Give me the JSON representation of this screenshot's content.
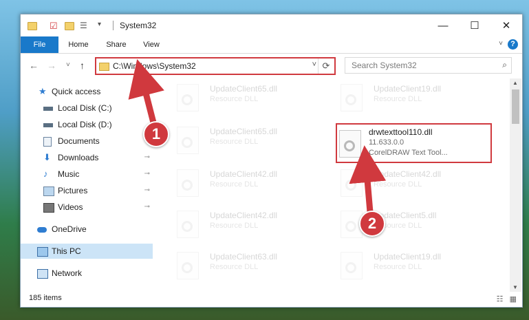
{
  "window": {
    "title": "System32",
    "controls": {
      "minimize": "—",
      "maximize": "☐",
      "close": "✕"
    }
  },
  "ribbon": {
    "tabs": [
      {
        "label": "File"
      },
      {
        "label": "Home"
      },
      {
        "label": "Share"
      },
      {
        "label": "View"
      }
    ],
    "help": "?",
    "chevron": "˅"
  },
  "address": {
    "path": "C:\\Windows\\System32",
    "dropdown": "˅",
    "refresh": "⟳"
  },
  "search": {
    "placeholder": "Search System32",
    "icon": "⌕"
  },
  "nav": {
    "back": "←",
    "forward": "→",
    "recent": "˅",
    "up": "↑"
  },
  "sidebar": {
    "items": [
      {
        "label": "Quick access",
        "icon": "star-icon"
      },
      {
        "label": "Local Disk (C:)",
        "icon": "drive-icon"
      },
      {
        "label": "Local Disk (D:)",
        "icon": "drive-icon"
      },
      {
        "label": "Documents",
        "icon": "documents-icon",
        "pinned": true
      },
      {
        "label": "Downloads",
        "icon": "download-icon",
        "pinned": true
      },
      {
        "label": "Music",
        "icon": "music-icon",
        "pinned": true
      },
      {
        "label": "Pictures",
        "icon": "pictures-icon",
        "pinned": true
      },
      {
        "label": "Videos",
        "icon": "videos-icon",
        "pinned": true
      },
      {
        "label": "OneDrive",
        "icon": "cloud-icon"
      },
      {
        "label": "This PC",
        "icon": "computer-icon",
        "selected": true
      },
      {
        "label": "Network",
        "icon": "network-icon"
      }
    ],
    "pin_glyph": "📌"
  },
  "files": {
    "left": [
      {
        "name": "UpdateClient65.dll",
        "type": "Resource DLL"
      },
      {
        "name": "UpdateClient65.dll",
        "type": "Resource DLL"
      },
      {
        "name": "UpdateClient42.dll",
        "type": "Resource DLL"
      },
      {
        "name": "UpdateClient42.dll",
        "type": "Resource DLL"
      },
      {
        "name": "UpdateClient63.dll",
        "type": "Resource DLL"
      },
      {
        "name": "UpdateClient42.dll",
        "type": "Resource DLL"
      }
    ],
    "right": [
      {
        "name": "UpdateClient19.dll",
        "type": "Resource DLL"
      },
      {
        "name": "UpdateClient42.dll",
        "type": "Resource DLL"
      },
      {
        "name": "UpdateClient5.dll",
        "type": "Resource DLL"
      },
      {
        "name": "UpdateClient19.dll",
        "type": "Resource DLL"
      },
      {
        "name": "UpdateClient42.dll",
        "type": "Resource DLL"
      }
    ],
    "target": {
      "name": "drwtexttool110.dll",
      "version": "11.633.0.0",
      "description": "CorelDRAW Text Tool..."
    }
  },
  "status": {
    "item_count": "185 items"
  },
  "callouts": [
    {
      "number": "1"
    },
    {
      "number": "2"
    }
  ],
  "colors": {
    "accent": "#1979ca",
    "highlight": "#d0393e",
    "selection": "#cce4f7"
  }
}
